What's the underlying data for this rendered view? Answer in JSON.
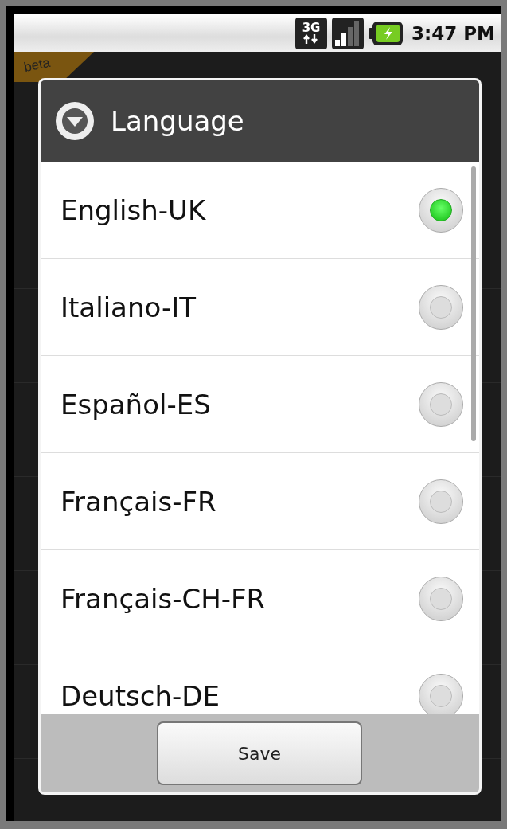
{
  "status_bar": {
    "network": "3G",
    "time": "3:47 PM"
  },
  "app": {
    "badge": "beta"
  },
  "dialog": {
    "title": "Language",
    "options": [
      {
        "label": "English-UK",
        "selected": true
      },
      {
        "label": "Italiano-IT",
        "selected": false
      },
      {
        "label": "Español-ES",
        "selected": false
      },
      {
        "label": "Français-FR",
        "selected": false
      },
      {
        "label": "Français-CH-FR",
        "selected": false
      },
      {
        "label": "Deutsch-DE",
        "selected": false
      }
    ],
    "buttons": [
      "Save"
    ]
  }
}
